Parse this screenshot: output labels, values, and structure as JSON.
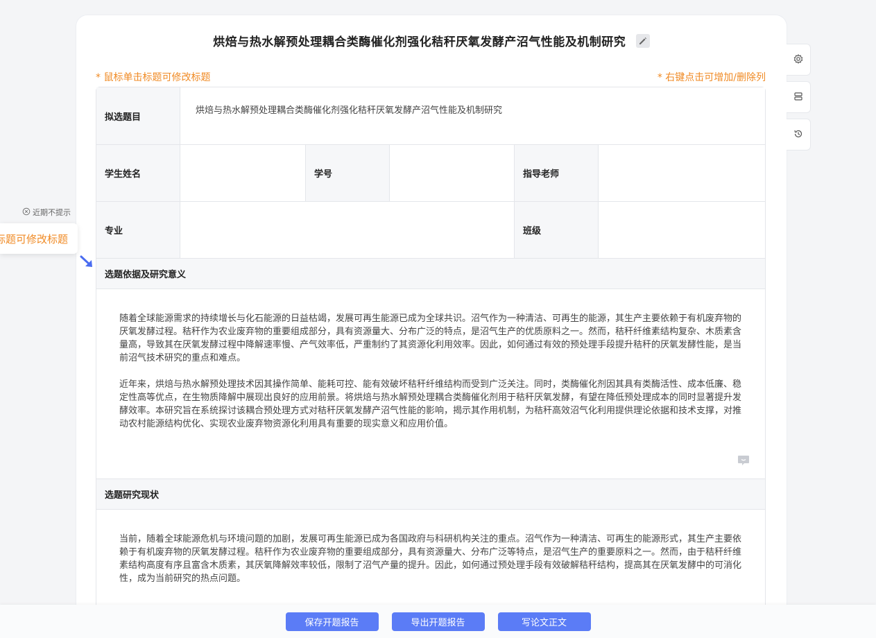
{
  "title": "烘焙与热水解预处理耦合类酶催化剂强化秸秆厌氧发酵产沼气性能及机制研究",
  "hints": {
    "left": "* 鼠标单击标题可修改标题",
    "right": "* 右键点击可增加/删除列"
  },
  "form": {
    "topic_label": "拟选题目",
    "topic_value": "烘焙与热水解预处理耦合类酶催化剂强化秸秆厌氧发酵产沼气性能及机制研究",
    "student_name_label": "学生姓名",
    "student_name_value": "",
    "student_id_label": "学号",
    "student_id_value": "",
    "advisor_label": "指导老师",
    "advisor_value": "",
    "major_label": "专业",
    "major_value": "",
    "class_label": "班级",
    "class_value": ""
  },
  "sections": [
    {
      "heading": "选题依据及研究意义",
      "paragraphs": [
        "随着全球能源需求的持续增长与化石能源的日益枯竭，发展可再生能源已成为全球共识。沼气作为一种清洁、可再生的能源，其生产主要依赖于有机废弃物的厌氧发酵过程。秸秆作为农业废弃物的重要组成部分，具有资源量大、分布广泛的特点，是沼气生产的优质原料之一。然而，秸秆纤维素结构复杂、木质素含量高，导致其在厌氧发酵过程中降解速率慢、产气效率低，严重制约了其资源化利用效率。因此，如何通过有效的预处理手段提升秸秆的厌氧发酵性能，是当前沼气技术研究的重点和难点。",
        "近年来，烘焙与热水解预处理技术因其操作简单、能耗可控、能有效破坏秸秆纤维结构而受到广泛关注。同时，类酶催化剂因其具有类酶活性、成本低廉、稳定性高等优点，在生物质降解中展现出良好的应用前景。将烘焙与热水解预处理耦合类酶催化剂用于秸秆厌氧发酵，有望在降低预处理成本的同时显著提升发酵效率。本研究旨在系统探讨该耦合预处理方式对秸秆厌氧发酵产沼气性能的影响，揭示其作用机制，为秸秆高效沼气化利用提供理论依据和技术支撑，对推动农村能源结构优化、实现农业废弃物资源化利用具有重要的现实意义和应用价值。"
      ]
    },
    {
      "heading": "选题研究现状",
      "paragraphs": [
        "当前，随着全球能源危机与环境问题的加剧，发展可再生能源已成为各国政府与科研机构关注的重点。沼气作为一种清洁、可再生的能源形式，其生产主要依赖于有机废弃物的厌氧发酵过程。秸秆作为农业废弃物的重要组成部分，具有资源量大、分布广泛等特点，是沼气生产的重要原料之一。然而，由于秸秆纤维素结构高度有序且富含木质素，其厌氧降解效率较低，限制了沼气产量的提升。因此，如何通过预处理手段有效破解秸秆结构，提高其在厌氧发酵中的可消化性，成为当前研究的热点问题。"
      ]
    }
  ],
  "tip": {
    "dismiss": "近期不提示",
    "bubble": "* 鼠标单击标题可修改标题"
  },
  "actions": {
    "save": "保存开题报告",
    "export": "导出开题报告",
    "write": "写论文正文"
  },
  "icons": {
    "edit": "pencil-icon",
    "settings": "gear-icon",
    "layout": "stack-icon",
    "history": "history-icon",
    "comment": "comment-icon",
    "dismiss": "close-circle-icon",
    "arrow": "arrow-down-right-icon"
  },
  "colors": {
    "accent": "#5b7cf6",
    "hint": "#f08a24"
  }
}
